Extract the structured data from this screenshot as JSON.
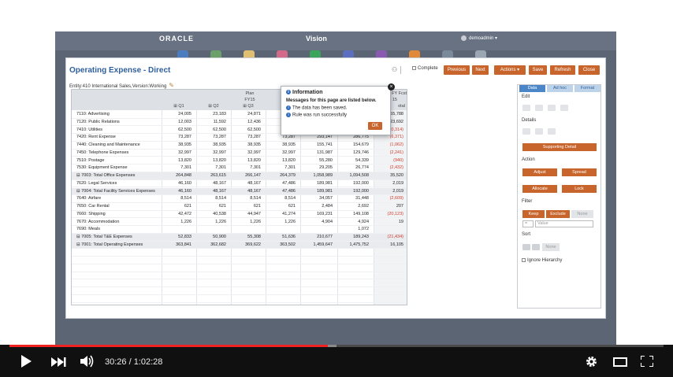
{
  "app": {
    "logo": "ORACLE",
    "title": "Vision",
    "user": "demoadmin ▾"
  },
  "page": {
    "title": "Operating Expense - Direct",
    "pov": "Entity:410 International Sales,Version:Working"
  },
  "toolbar": {
    "complete": "Complete",
    "previous": "Previous",
    "next": "Next",
    "actions": "Actions ▾",
    "save": "Save",
    "refresh": "Refresh",
    "close": "Close"
  },
  "grid": {
    "scenario": "Plan",
    "year": "FY15",
    "fcst_head": "FY Fcst",
    "fcst_year": "15",
    "fcst_col": "otal",
    "cols": [
      "⊞ Q1",
      "⊞ Q2",
      "⊞ Q3"
    ],
    "rows": [
      {
        "label": "7110: Advertising",
        "v": [
          "24,005",
          "23,183",
          "24,871",
          "",
          "",
          "55,788"
        ],
        "neg": false,
        "tot": false
      },
      {
        "label": "7120: Public Relations",
        "v": [
          "12,003",
          "11,592",
          "12,436",
          "",
          "",
          "23,692"
        ],
        "neg": false,
        "tot": false
      },
      {
        "label": "7410: Utilities",
        "v": [
          "62,500",
          "62,500",
          "62,500",
          "",
          "",
          "(0,314)"
        ],
        "neg": true,
        "tot": false
      },
      {
        "label": "7420: Rent Expense",
        "v": [
          "73,287",
          "73,287",
          "73,287",
          "73,287",
          "293,147",
          "286,775",
          "(6,371)"
        ],
        "neg": true,
        "tot": false
      },
      {
        "label": "7440: Cleaning and Maintenance",
        "v": [
          "38,935",
          "38,935",
          "38,935",
          "38,935",
          "155,741",
          "154,679",
          "(1,062)"
        ],
        "neg": true,
        "tot": false
      },
      {
        "label": "7450: Telephone Expenses",
        "v": [
          "32,997",
          "32,997",
          "32,997",
          "32,997",
          "131,987",
          "129,746",
          "(2,241)"
        ],
        "neg": true,
        "tot": false
      },
      {
        "label": "7510: Postage",
        "v": [
          "13,820",
          "13,820",
          "13,820",
          "13,820",
          "55,280",
          "54,339",
          "(940)"
        ],
        "neg": true,
        "tot": false
      },
      {
        "label": "7530: Equipment Expense",
        "v": [
          "7,301",
          "7,301",
          "7,301",
          "7,301",
          "29,205",
          "26,774",
          "(2,432)"
        ],
        "neg": true,
        "tot": false
      },
      {
        "label": "⊟ 7003: Total Office Expenses",
        "v": [
          "264,848",
          "263,615",
          "266,147",
          "264,379",
          "1,058,989",
          "1,094,508",
          "35,520"
        ],
        "neg": false,
        "tot": true
      },
      {
        "label": "7620: Legal Services",
        "v": [
          "46,160",
          "48,167",
          "48,167",
          "47,486",
          "189,981",
          "192,000",
          "2,019"
        ],
        "neg": false,
        "tot": false
      },
      {
        "label": "⊟ 7004: Total Facility Services Expenses",
        "v": [
          "46,160",
          "48,167",
          "48,167",
          "47,486",
          "189,981",
          "192,000",
          "2,019"
        ],
        "neg": false,
        "tot": true
      },
      {
        "label": "7640: Airfare",
        "v": [
          "8,514",
          "8,514",
          "8,514",
          "8,514",
          "34,057",
          "31,448",
          "(2,609)"
        ],
        "neg": true,
        "tot": false
      },
      {
        "label": "7650: Car Rental",
        "v": [
          "621",
          "621",
          "621",
          "621",
          "2,484",
          "2,692",
          "207"
        ],
        "neg": false,
        "tot": false
      },
      {
        "label": "7660: Shipping",
        "v": [
          "42,472",
          "40,538",
          "44,947",
          "41,274",
          "169,231",
          "149,108",
          "(20,123)"
        ],
        "neg": true,
        "tot": false
      },
      {
        "label": "7670: Accommodation",
        "v": [
          "1,226",
          "1,226",
          "1,226",
          "1,226",
          "4,904",
          "4,924",
          "19"
        ],
        "neg": false,
        "tot": false
      },
      {
        "label": "7690: Meals",
        "v": [
          "",
          "",
          "",
          "",
          "",
          "1,072",
          ""
        ],
        "neg": false,
        "tot": false
      },
      {
        "label": "⊟ 7005: Total T&E Expenses",
        "v": [
          "52,833",
          "50,900",
          "55,308",
          "51,636",
          "210,677",
          "189,243",
          "(21,434)"
        ],
        "neg": true,
        "tot": true
      },
      {
        "label": "⊟ 7001: Total Operating Expenses",
        "v": [
          "363,841",
          "362,682",
          "369,622",
          "363,502",
          "1,459,647",
          "1,475,752",
          "16,105"
        ],
        "neg": false,
        "tot": true
      }
    ]
  },
  "right": {
    "tabs": [
      "Data",
      "Ad hoc",
      "Format"
    ],
    "edit": "Edit",
    "details": "Details",
    "supporting": "Supporting Detail",
    "action": "Action",
    "adjust": "Adjust",
    "spread": "Spread",
    "allocate": "Allocate",
    "lock": "Lock",
    "filter": "Filter",
    "keep": "Keep",
    "exclude": "Exclude",
    "none": "None",
    "op": "=",
    "value": "Value",
    "sort": "Sort",
    "sort_none": "None",
    "ignore": "Ignore Hierarchy"
  },
  "popup": {
    "title": "Information",
    "sub": "Messages for this page are listed below.",
    "m1": "The data has been saved.",
    "m2": "Rule was run successfully",
    "ok": "OK"
  },
  "player": {
    "time": "30:26 / 1:02:28",
    "progress": 0.487,
    "buffer": 0.5
  },
  "colors": {
    "accent": "#c8652c",
    "title": "#2f5f9d",
    "progress": "#ee2222"
  }
}
